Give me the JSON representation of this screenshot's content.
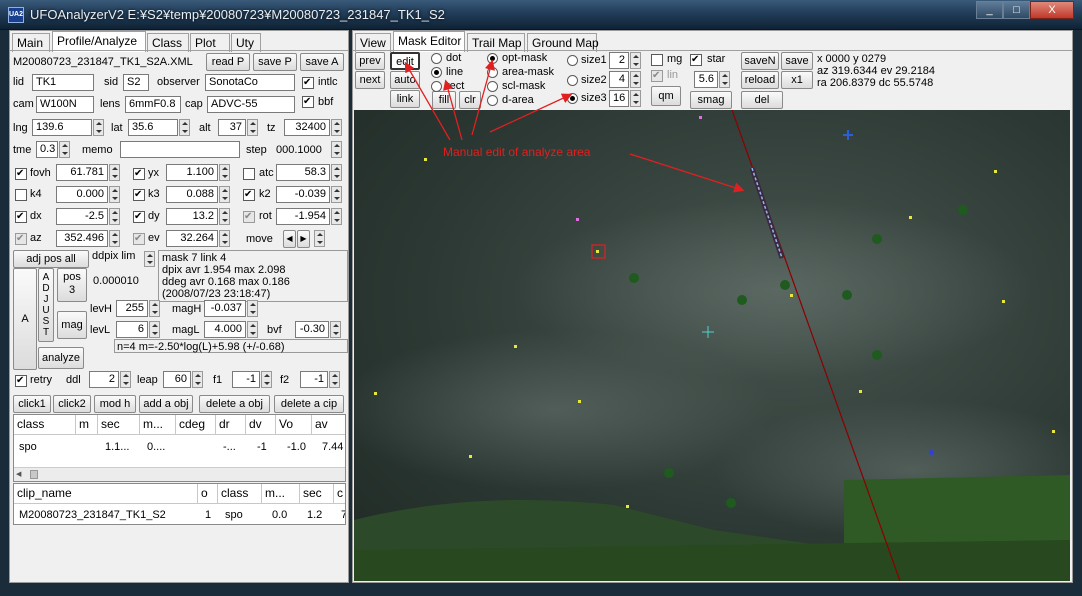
{
  "window": {
    "icon_text": "UA2",
    "title": "UFOAnalyzerV2 E:¥S2¥temp¥20080723¥M20080723_231847_TK1_S2",
    "min": "_",
    "max": "□",
    "close": "X"
  },
  "left_tabs": [
    "Main",
    "Profile/Analyze",
    "Class",
    "Plot",
    "Uty"
  ],
  "profile": {
    "file": "M20080723_231847_TK1_S2A.XML",
    "read_p": "read P",
    "save_p": "save P",
    "save_a": "save A",
    "lid_label": "lid",
    "lid": "TK1",
    "sid_label": "sid",
    "sid": "S2",
    "observer_label": "observer",
    "observer": "SonotaCo",
    "intlc": "intlc",
    "cam_label": "cam",
    "cam": "W100N",
    "lens_label": "lens",
    "lens": "6mmF0.8",
    "cap_label": "cap",
    "cap": "ADVC-55",
    "bbf": "bbf",
    "lng_label": "lng",
    "lng": "139.6",
    "lat_label": "lat",
    "lat": "35.6",
    "alt_label": "alt",
    "alt": "37",
    "tz_label": "tz",
    "tz": "32400",
    "tme_label": "tme",
    "tme": "0.3",
    "memo_label": "memo",
    "memo": "",
    "step_label": "step",
    "step": "000.1000",
    "fovh_label": "fovh",
    "fovh": "61.781",
    "yx_label": "yx",
    "yx": "1.100",
    "atc_label": "atc",
    "atc": "58.3",
    "k4_label": "k4",
    "k4": "0.000",
    "k3_label": "k3",
    "k3": "0.088",
    "k2_label": "k2",
    "k2": "-0.039",
    "dx_label": "dx",
    "dx": "-2.5",
    "dy_label": "dy",
    "dy": "13.2",
    "rot_label": "rot",
    "rot": "-1.954",
    "az_label": "az",
    "az": "352.496",
    "ev_label": "ev",
    "ev": "32.264",
    "move_label": "move",
    "adj_pos_all": "adj pos all",
    "ddpix_label": "ddpix lim",
    "ddpix": "0.000010",
    "pos3": "pos\n3",
    "info1": "mask 7  link 4",
    "info2": "dpix avr  1.954 max  2.098",
    "info3": "ddeg avr  0.168 max  0.186",
    "info4": "(2008/07/23 23:18:47)",
    "a_btn": "A",
    "adjust": "A\nD\nJ\nU\nS\nT",
    "mag_btn": "mag",
    "analyze_btn": "analyze",
    "levH_label": "levH",
    "levH": "255",
    "magH_label": "magH",
    "magH": "-0.037",
    "levL_label": "levL",
    "levL": "6",
    "magL_label": "magL",
    "magL": "4.000",
    "bvf_label": "bvf",
    "bvf": "-0.30",
    "formula": "n=4  m=-2.50*log(L)+5.98 (+/-0.68)",
    "retry": "retry",
    "ddl_label": "ddl",
    "ddl": "2",
    "leap_label": "leap",
    "leap": "60",
    "f1_label": "f1",
    "f1": "-1",
    "f2_label": "f2",
    "f2": "-1",
    "click1": "click1",
    "click2": "click2",
    "mod_h": "mod h",
    "add_obj": "add a obj",
    "delete_obj": "delete a obj",
    "delete_clip": "delete a cip"
  },
  "class_table": {
    "headers": [
      "class",
      "m",
      "sec",
      "m...",
      "cdeg",
      "dr",
      "dv",
      "Vo",
      "av"
    ],
    "row": [
      "spo",
      "",
      "1.1...",
      "0....",
      "-...",
      "-1",
      "-1.0",
      "7.44"
    ]
  },
  "clip_table": {
    "headers": [
      "clip_name",
      "o",
      "class",
      "m...",
      "sec",
      "c"
    ],
    "row": [
      "M20080723_231847_TK1_S2",
      "1",
      "spo",
      "0.0",
      "1.2",
      "7"
    ]
  },
  "right_tabs": [
    "View",
    "Mask Editor",
    "Trail Map",
    "Ground Map"
  ],
  "mask": {
    "prev": "prev",
    "next": "next",
    "edit": "edit",
    "auto": "auto",
    "link": "link",
    "fill": "fill",
    "clr": "clr",
    "dot": "dot",
    "line": "line",
    "rect": "rect",
    "opt_mask": "opt-mask",
    "area_mask": "area-mask",
    "scl_mask": "scl-mask",
    "d_area": "d-area",
    "size1": "size1",
    "size1_val": "2",
    "size2": "size2",
    "size2_val": "4",
    "size3": "size3",
    "size3_val": "16",
    "mg": "mg",
    "lin": "lin",
    "qm": "qm",
    "star": "star",
    "star_val": "5.6",
    "smag": "smag",
    "saveN": "saveN",
    "save": "save",
    "reload": "reload",
    "x1": "x1",
    "del": "del",
    "coord1": "x 0000  y 0279",
    "coord2": "az 319.6344 ev 29.2184",
    "coord3": "ra 206.8379 dc 55.5748"
  },
  "annotation": "Manual edit of analyze area",
  "colors": {
    "accent_red": "#e02020",
    "trail_line": "#8b0000",
    "ground": "#2f5a25"
  }
}
